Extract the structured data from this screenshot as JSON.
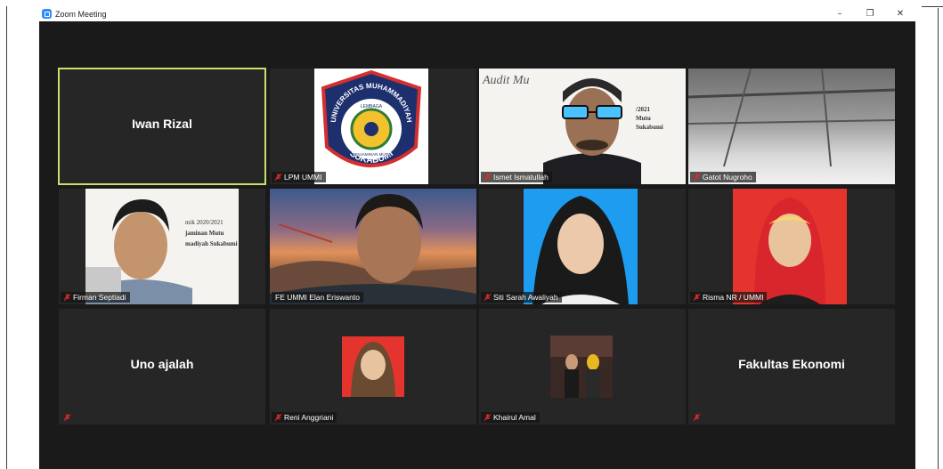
{
  "window": {
    "title": "Zoom Meeting",
    "minimize": "–",
    "maximize": "❐",
    "close": "✕"
  },
  "participants": [
    {
      "name": "Iwan Rizal",
      "display": "Iwan Rizal",
      "video": false,
      "active_speaker": true,
      "muted": false
    },
    {
      "name": "LPM UMMI",
      "video": true,
      "muted": true
    },
    {
      "name": "Ismet Ismatullah",
      "video": true,
      "muted": true
    },
    {
      "name": "Gatot Nugroho",
      "video": true,
      "muted": true
    },
    {
      "name": "Firman Septiadi",
      "video": true,
      "muted": true
    },
    {
      "name": "FE UMMI Elan Eriswanto",
      "video": true,
      "muted": false
    },
    {
      "name": "Siti Sarah Awaliyah",
      "video": true,
      "muted": true
    },
    {
      "name": "Risma NR / UMMI",
      "video": true,
      "muted": true
    },
    {
      "name": "",
      "display": "Uno ajalah",
      "video": false,
      "muted": true
    },
    {
      "name": "Reni Anggriani",
      "video": true,
      "muted": true
    },
    {
      "name": "Khairul Amal",
      "video": true,
      "muted": true
    },
    {
      "name": "",
      "display": "Fakultas Ekonomi",
      "video": false,
      "muted": true
    }
  ],
  "logo": {
    "top_text": "UNIVERSITAS MUHAMMADIYAH",
    "inner_top": "LEMBAGA",
    "inner_bottom": "PENJAMINAN MUTU",
    "bottom_text": "SUKABUMI"
  },
  "slide": {
    "line1": "Audit Mu",
    "line2": "/2021",
    "line3": "Mutu",
    "line4": "Sukabumi",
    "firman_line1": "mik 2020/2021",
    "firman_line2": "jaminan Mutu",
    "firman_line3": "madiyah Sukabumi"
  },
  "colors": {
    "stage": "#1a1a1a",
    "tile": "#262626",
    "active_border": "#c7e06b",
    "muted_icon": "#e02828",
    "zoom_blue": "#2d8cff"
  }
}
